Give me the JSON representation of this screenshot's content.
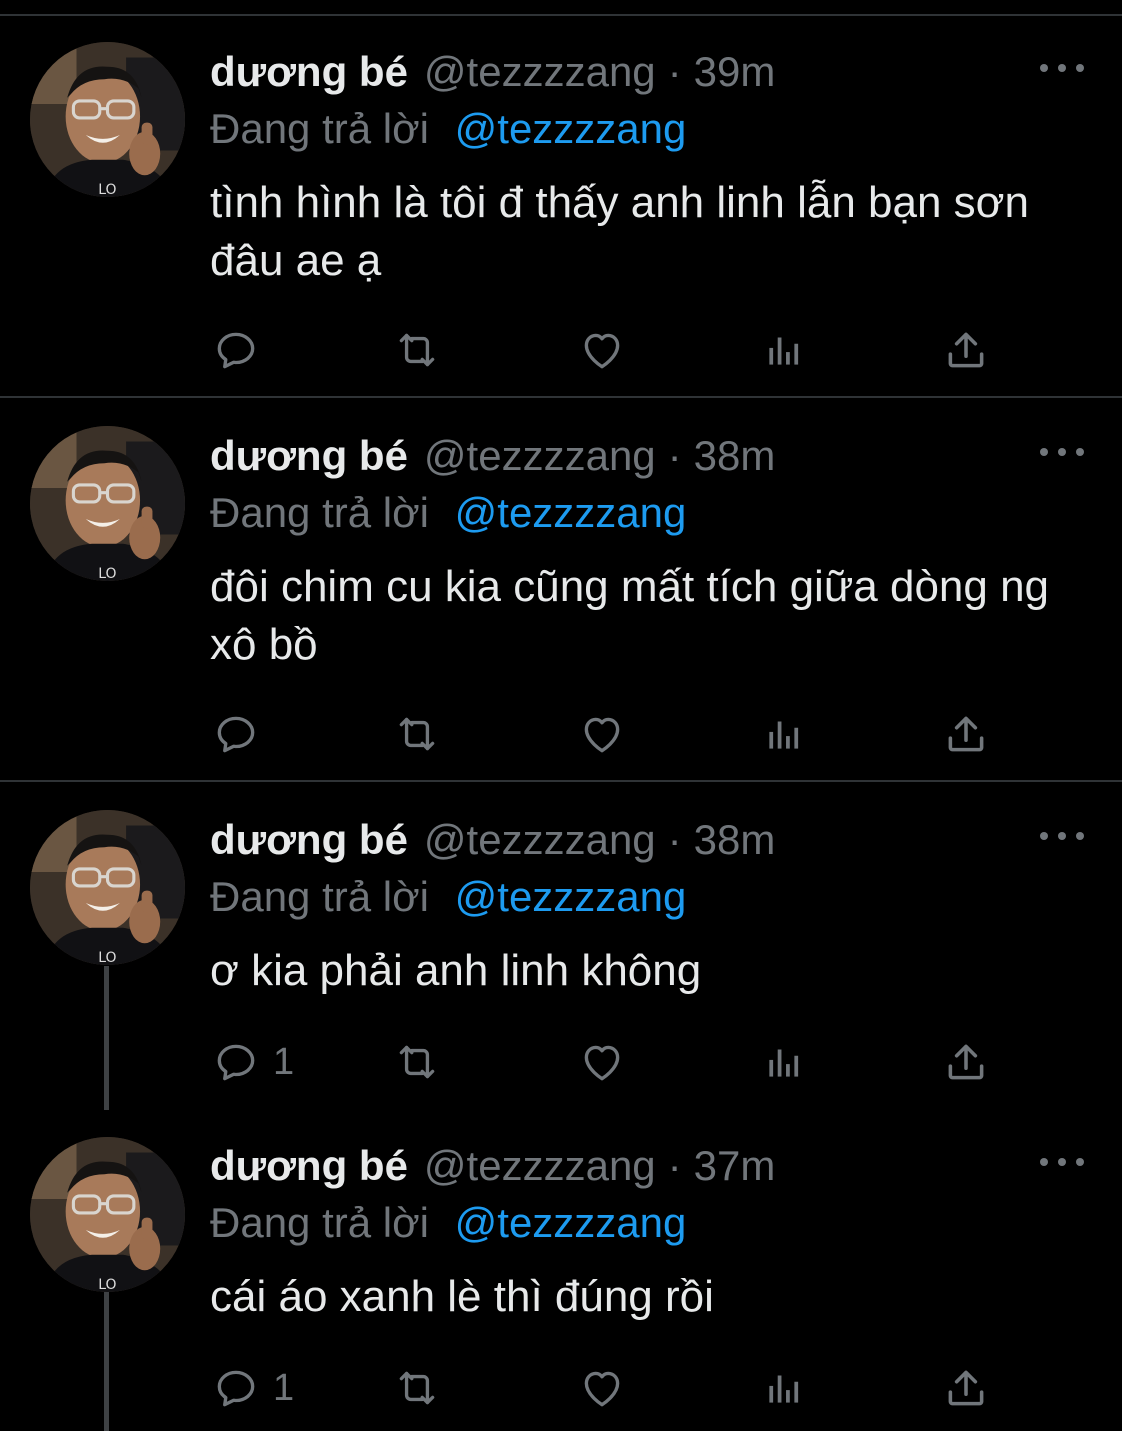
{
  "colors": {
    "background": "#000000",
    "divider": "#2f3336",
    "primary_text": "#e7e9ea",
    "secondary_text": "#71767b",
    "mention": "#1d9bf0"
  },
  "icons": {
    "reply": "reply-icon",
    "retweet": "retweet-icon",
    "like": "heart-icon",
    "views": "views-icon",
    "share": "share-icon",
    "more": "more-icon"
  },
  "tweets": [
    {
      "author_name": "dương bé",
      "handle": "@tezzzzang",
      "separator": "·",
      "time": "39m",
      "replying_prefix": "Đang trả lời",
      "replying_to": "@tezzzzang",
      "text": "tình hình là tôi đ thấy anh linh lẫn bạn sơn đâu ae ạ",
      "reply_count": ""
    },
    {
      "author_name": "dương bé",
      "handle": "@tezzzzang",
      "separator": "·",
      "time": "38m",
      "replying_prefix": "Đang trả lời",
      "replying_to": "@tezzzzang",
      "text": "đôi chim cu kia cũng mất tích giữa dòng ng xô bồ",
      "reply_count": ""
    },
    {
      "author_name": "dương bé",
      "handle": "@tezzzzang",
      "separator": "·",
      "time": "38m",
      "replying_prefix": "Đang trả lời",
      "replying_to": "@tezzzzang",
      "text": "ơ kia phải anh linh không",
      "reply_count": "1"
    },
    {
      "author_name": "dương bé",
      "handle": "@tezzzzang",
      "separator": "·",
      "time": "37m",
      "replying_prefix": "Đang trả lời",
      "replying_to": "@tezzzzang",
      "text": "cái áo xanh lè thì đúng rồi",
      "reply_count": "1"
    }
  ]
}
